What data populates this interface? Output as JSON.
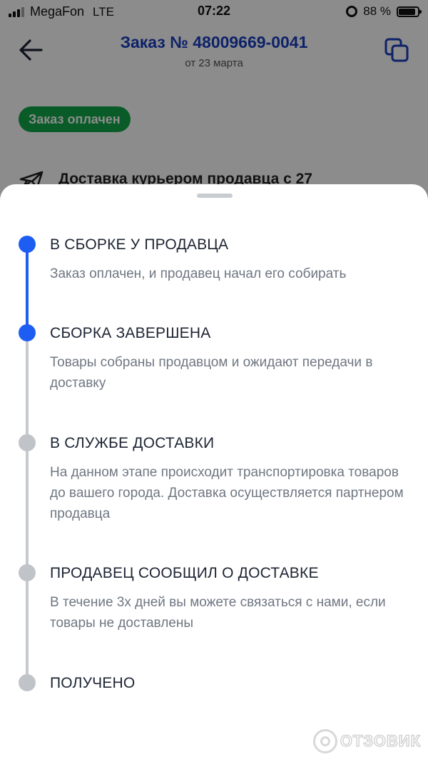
{
  "status_bar": {
    "carrier": "MegaFon",
    "network": "LTE",
    "time": "07:22",
    "battery": "88 %",
    "battery_level": 0.88
  },
  "header": {
    "title": "Заказ № 48009669-0041",
    "subtitle": "от 23 марта",
    "icons": {
      "back": "arrow-left-icon",
      "copy": "copy-icon"
    }
  },
  "order": {
    "status_badge": "Заказ оплачен",
    "delivery_text": "Доставка курьером продавца с 27",
    "delivery_icon": "plane-icon"
  },
  "colors": {
    "accent": "#1d5df2",
    "title_blue": "#1a3fbf",
    "badge_green": "#12a84a",
    "inactive": "#c0c4c9"
  },
  "timeline": {
    "steps": [
      {
        "title": "В СБОРКЕ У ПРОДАВЦА",
        "description": "Заказ оплачен, и продавец начал его собирать",
        "state": "done"
      },
      {
        "title": "СБОРКА ЗАВЕРШЕНА",
        "description": "Товары собраны продавцом и ожидают передачи в доставку",
        "state": "done"
      },
      {
        "title": "В СЛУЖБЕ ДОСТАВКИ",
        "description": "На данном этапе происходит транспортировка товаров до вашего города. Доставка осуществляется партнером продавца",
        "state": "pending"
      },
      {
        "title": "ПРОДАВЕЦ СООБЩИЛ О ДОСТАВКЕ",
        "description": "В течение 3х дней вы можете связаться с нами, если товары не доставлены",
        "state": "pending"
      },
      {
        "title": "ПОЛУЧЕНО",
        "description": "",
        "state": "pending"
      }
    ]
  },
  "watermark": {
    "text": "ОТЗОВИК"
  }
}
